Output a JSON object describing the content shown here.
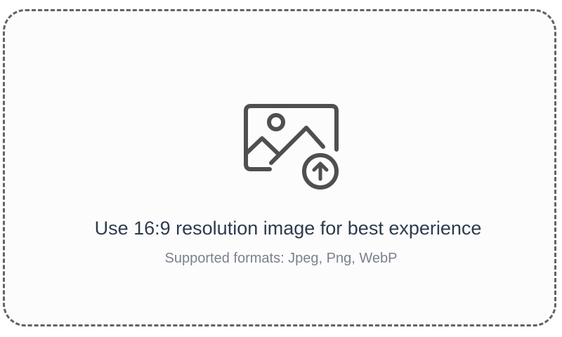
{
  "upload": {
    "title": "Use 16:9 resolution image for best experience",
    "subtitle": "Supported formats: Jpeg, Png, WebP",
    "icon": "image-upload-icon"
  },
  "colors": {
    "border": "#5f6368",
    "icon": "#4f4f51",
    "title": "#2f3b4c",
    "subtitle": "#7a818d"
  }
}
